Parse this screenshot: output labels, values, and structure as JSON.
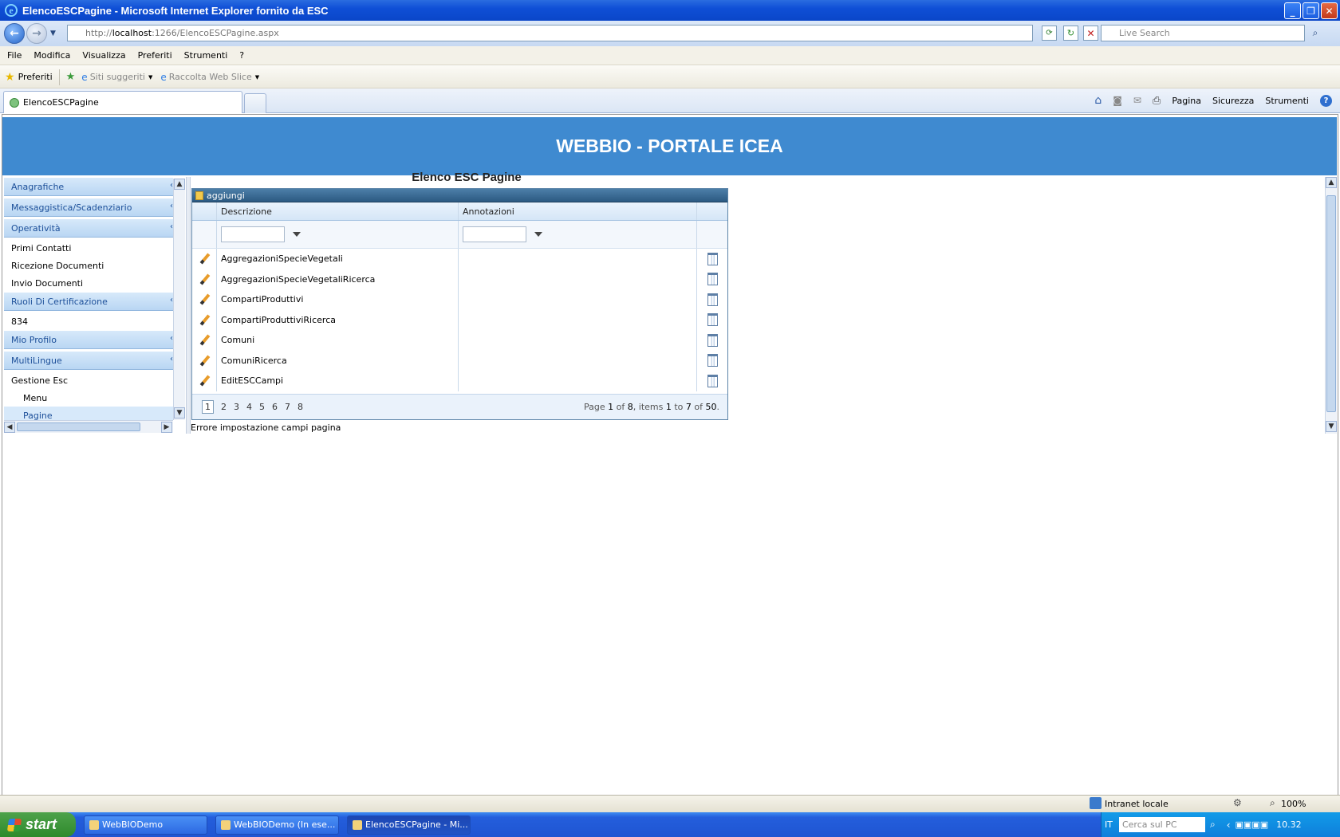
{
  "window": {
    "title": "ElencoESCPagine - Microsoft Internet Explorer fornito da ESC"
  },
  "address": {
    "prefix": "http://",
    "host": "localhost",
    "path": ":1266/ElencoESCPagine.aspx",
    "search_placeholder": "Live Search"
  },
  "menu": [
    "File",
    "Modifica",
    "Visualizza",
    "Preferiti",
    "Strumenti",
    "?"
  ],
  "favorites": {
    "label": "Preferiti",
    "suggested": "Siti suggeriti",
    "webslice": "Raccolta Web Slice"
  },
  "tab": {
    "label": "ElencoESCPagine"
  },
  "commands": {
    "page": "Pagina",
    "security": "Sicurezza",
    "tools": "Strumenti"
  },
  "header": {
    "title": "WEBBIO - PORTALE ICEA"
  },
  "sidebar": {
    "groups": [
      {
        "label": "Anagrafiche",
        "items": []
      },
      {
        "label": "Messaggistica/Scadenziario",
        "items": []
      },
      {
        "label": "Operatività",
        "items": [
          "Primi Contatti",
          "Ricezione Documenti",
          "Invio Documenti"
        ]
      },
      {
        "label": "Ruoli Di Certificazione",
        "items": [
          "834"
        ]
      },
      {
        "label": "Mio Profilo",
        "items": []
      },
      {
        "label": "MultiLingue",
        "items": [
          "Gestione Esc"
        ]
      }
    ],
    "subitems": [
      "Menu",
      "Pagine"
    ]
  },
  "content": {
    "title": "Elenco ESC Pagine",
    "error": "Errore impostazione campi pagina"
  },
  "grid": {
    "add_label": "aggiungi",
    "columns": [
      "Descrizione",
      "Annotazioni"
    ],
    "rows": [
      "AggregazioniSpecieVegetali",
      "AggregazioniSpecieVegetaliRicerca",
      "CompartiProduttivi",
      "CompartiProduttiviRicerca",
      "Comuni",
      "ComuniRicerca",
      "EditESCCampi"
    ],
    "pages": [
      "1",
      "2",
      "3",
      "4",
      "5",
      "6",
      "7",
      "8"
    ],
    "page_info": {
      "t1": "Page ",
      "cur": "1",
      "t2": " of ",
      "total": "8",
      "t3": ", items ",
      "from": "1",
      "t4": " to ",
      "to": "7",
      "t5": " of ",
      "count": "50",
      "t6": "."
    }
  },
  "status": {
    "zone": "Intranet locale",
    "zoom": "100%"
  },
  "taskbar": {
    "start": "start",
    "tasks": [
      "WebBIODemo",
      "WebBIODemo (In ese...",
      "ElencoESCPagine - Mi..."
    ],
    "lang": "IT",
    "search": "Cerca sul PC",
    "clock": "10.32"
  }
}
